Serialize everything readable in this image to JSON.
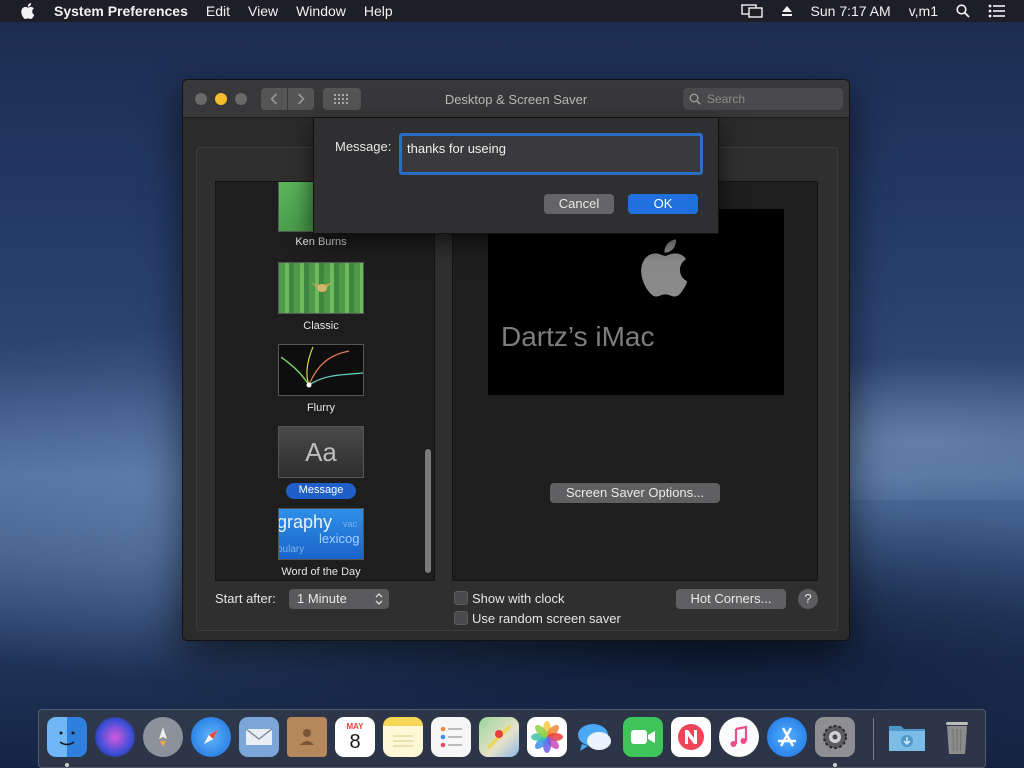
{
  "menubar": {
    "app_name": "System Preferences",
    "menus": [
      "Edit",
      "View",
      "Window",
      "Help"
    ],
    "clock": "Sun 7:17 AM",
    "user": "v,m1"
  },
  "window": {
    "title": "Desktop & Screen Saver",
    "search_placeholder": "Search"
  },
  "savers": [
    {
      "label": "Ken Burns"
    },
    {
      "label": "Classic"
    },
    {
      "label": "Flurry"
    },
    {
      "label": "Message",
      "selected": true,
      "thumb_text": "Aa"
    },
    {
      "label": "Word of the Day",
      "thumb_text": [
        "graphy",
        "lexicog",
        "bulary",
        "vac"
      ]
    }
  ],
  "preview": {
    "machine_name": "Dartz’s iMac"
  },
  "options_button": "Screen Saver Options...",
  "start_after": {
    "label": "Start after:",
    "value": "1 Minute"
  },
  "checkboxes": {
    "show_clock": {
      "label": "Show with clock",
      "checked": false
    },
    "random": {
      "label": "Use random screen saver",
      "checked": false
    }
  },
  "hot_corners": "Hot Corners...",
  "help": "?",
  "sheet": {
    "label": "Message:",
    "value": "thanks for useing",
    "cancel": "Cancel",
    "ok": "OK"
  },
  "dock": {
    "apps": [
      {
        "name": "finder-icon",
        "color": "#3a8ee6"
      },
      {
        "name": "siri-icon",
        "color": "#2a2a3a"
      },
      {
        "name": "launchpad-icon",
        "color": "#7d8794"
      },
      {
        "name": "safari-icon",
        "color": "#2d7ee0"
      },
      {
        "name": "mail-icon",
        "color": "#6f9fd0"
      },
      {
        "name": "contacts-icon",
        "color": "#b58a52"
      },
      {
        "name": "calendar-icon",
        "color": "#ffffff"
      },
      {
        "name": "notes-icon",
        "color": "#f5e27a"
      },
      {
        "name": "reminders-icon",
        "color": "#f4f4f4"
      },
      {
        "name": "maps-icon",
        "color": "#7cc27c"
      },
      {
        "name": "photos-icon",
        "color": "#ffffff"
      },
      {
        "name": "messages-icon",
        "color": "#4aa8f5"
      },
      {
        "name": "facetime-icon",
        "color": "#3fc45a"
      },
      {
        "name": "news-icon",
        "color": "#f04558"
      },
      {
        "name": "itunes-icon",
        "color": "#ef4d8a"
      },
      {
        "name": "app-store-icon",
        "color": "#2c8cf0"
      },
      {
        "name": "system-preferences-icon",
        "color": "#8e8e93"
      },
      {
        "name": "downloads-folder-icon",
        "color": "#5fa8d6"
      },
      {
        "name": "trash-icon",
        "color": "#9a9a9a"
      }
    ],
    "calendar_month": "MAY",
    "calendar_day": "8"
  }
}
